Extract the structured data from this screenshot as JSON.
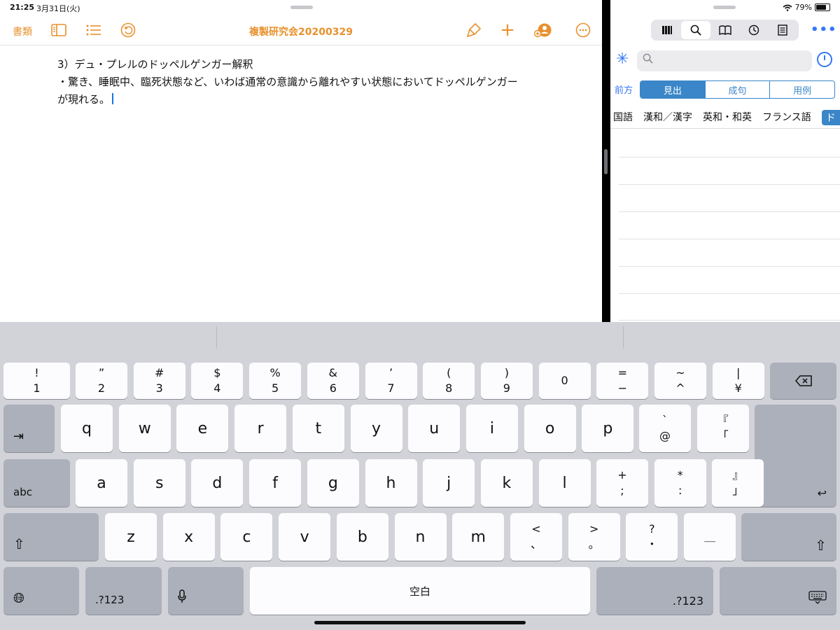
{
  "status_bar": {
    "time": "21:25",
    "date": "3月31日(火)",
    "battery": "79%"
  },
  "pages": {
    "toolbar": {
      "documents_label": "書類",
      "title": "複製研究会20200329"
    },
    "document": {
      "lines": [
        "3）デュ・プレルのドッペルゲンガー解釈",
        "・驚き、睡眠中、臨死状態など、いわば通常の意識から離れやすい状態においてドッペルゲンガー",
        "が現れる。"
      ]
    }
  },
  "dictionary": {
    "search": {
      "placeholder": ""
    },
    "match_label": "前方",
    "modes": [
      "見出",
      "成句",
      "用例"
    ],
    "active_mode": "見出",
    "categories": [
      "国語",
      "漢和／漢字",
      "英和・和英",
      "フランス語",
      "ド"
    ]
  },
  "keyboard": {
    "row1": [
      {
        "t": "!",
        "b": "1"
      },
      {
        "t": "”",
        "b": "2"
      },
      {
        "t": "#",
        "b": "3"
      },
      {
        "t": "$",
        "b": "4"
      },
      {
        "t": "%",
        "b": "5"
      },
      {
        "t": "&",
        "b": "6"
      },
      {
        "t": "’",
        "b": "7"
      },
      {
        "t": "(",
        "b": "8"
      },
      {
        "t": ")",
        "b": "9"
      },
      {
        "t": "",
        "b": "0"
      },
      {
        "t": "=",
        "b": "−"
      },
      {
        "t": "~",
        "b": "^"
      },
      {
        "t": "|",
        "b": "¥"
      }
    ],
    "row2": [
      "q",
      "w",
      "e",
      "r",
      "t",
      "y",
      "u",
      "i",
      "o",
      "p"
    ],
    "row2_extra": [
      {
        "t": "`",
        "b": "@"
      },
      {
        "t": "『",
        "b": "「"
      }
    ],
    "row3": [
      "a",
      "s",
      "d",
      "f",
      "g",
      "h",
      "j",
      "k",
      "l"
    ],
    "row3_extra": [
      {
        "t": "+",
        "b": ";"
      },
      {
        "t": "*",
        "b": ":"
      },
      {
        "t": "』",
        "b": "」"
      }
    ],
    "row4": [
      "z",
      "x",
      "c",
      "v",
      "b",
      "n",
      "m"
    ],
    "row4_extra": [
      {
        "t": "<",
        "b": "、"
      },
      {
        "t": ">",
        "b": "。"
      },
      {
        "t": "?",
        "b": "・"
      },
      {
        "t": "",
        "b": "＿"
      }
    ],
    "abc_label": "abc",
    "numbers_label": ".?123",
    "space_label": "空白"
  }
}
